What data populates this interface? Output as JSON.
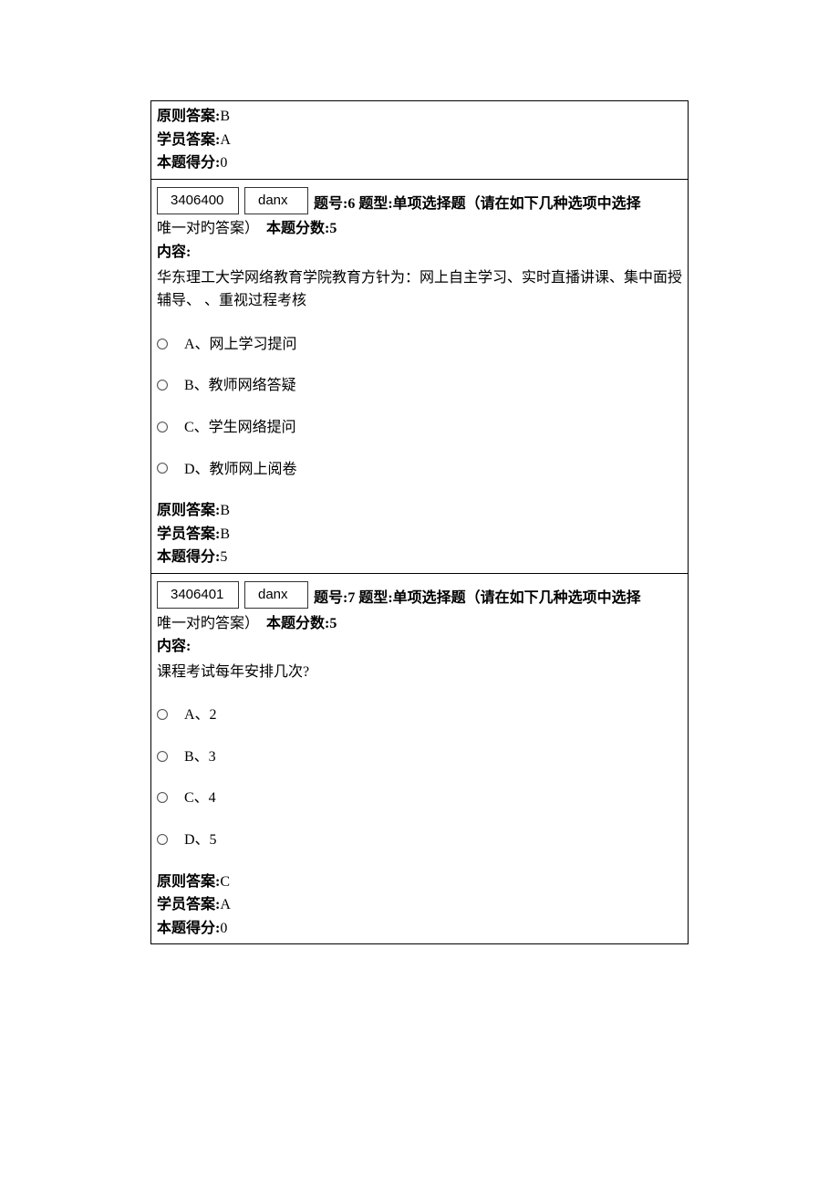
{
  "block1": {
    "correct_label": "原则答案:",
    "correct_value": "B",
    "student_label": "学员答案:",
    "student_value": "A",
    "score_label": "本题得分:",
    "score_value": "0"
  },
  "q6": {
    "id": "3406400",
    "type_code": "danx",
    "header_line1": "题号:6 题型:单项选择题（请在如下几种选项中选择",
    "header_line2": "唯一对旳答案）",
    "score_label": "本题分数:5",
    "content_label": "内容:",
    "content_text": "华东理工大学网络教育学院教育方针为：网上自主学习、实时直播讲课、集中面授辅导、 、重视过程考核",
    "options": {
      "a": "A、网上学习提问",
      "b": "B、教师网络答疑",
      "c": "C、学生网络提问",
      "d": "D、教师网上阅卷"
    },
    "correct_label": "原则答案:",
    "correct_value": "B",
    "student_label": "学员答案:",
    "student_value": "B",
    "result_score_label": "本题得分:",
    "result_score_value": "5"
  },
  "q7": {
    "id": "3406401",
    "type_code": "danx",
    "header_line1": "题号:7 题型:单项选择题（请在如下几种选项中选择",
    "header_line2": "唯一对旳答案）",
    "score_label": "本题分数:5",
    "content_label": "内容:",
    "content_text": "课程考试每年安排几次?",
    "options": {
      "a": "A、2",
      "b": "B、3",
      "c": "C、4",
      "d": "D、5"
    },
    "correct_label": "原则答案:",
    "correct_value": "C",
    "student_label": "学员答案:",
    "student_value": "A",
    "result_score_label": "本题得分:",
    "result_score_value": "0"
  }
}
